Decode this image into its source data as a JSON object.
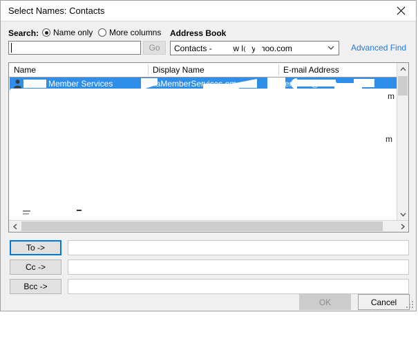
{
  "dialog": {
    "title": "Select Names: Contacts",
    "close_icon": "close-icon"
  },
  "search": {
    "label": "Search:",
    "input_value": "",
    "go_label": "Go",
    "go_enabled": false,
    "options": [
      {
        "label": "Name only",
        "selected": true
      },
      {
        "label": "More columns",
        "selected": false
      }
    ]
  },
  "address_book": {
    "label": "Address Book",
    "selected": "Contacts - hart_w l@yahoo.com",
    "dropdown_icon": "chevron-down-icon"
  },
  "advanced_find": {
    "label": "Advanced Find"
  },
  "list": {
    "columns": [
      "Name",
      "Display Name",
      "E-mail Address"
    ],
    "rows": [
      {
        "icon": "person-icon",
        "name": "Member Services",
        "display_name": "naMemberServices om",
        "email": "Services@ com",
        "selected": true
      }
    ],
    "stray_fragments": [
      "m",
      "m"
    ],
    "vertical_scrollbar": {
      "up_icon": "chevron-up-icon",
      "down_icon": "chevron-down-icon"
    },
    "horizontal_scrollbar": {
      "left_icon": "chevron-left-icon",
      "right_icon": "chevron-right-icon"
    }
  },
  "recipients": [
    {
      "button": "To ->",
      "value": "",
      "focused": true
    },
    {
      "button": "Cc ->",
      "value": "",
      "focused": false
    },
    {
      "button": "Bcc ->",
      "value": "",
      "focused": false
    }
  ],
  "footer": {
    "ok_label": "OK",
    "ok_enabled": false,
    "cancel_label": "Cancel"
  },
  "colors": {
    "selection_blue": "#2f8fe8",
    "link_blue": "#2577d4",
    "focus_blue": "#0078d7",
    "dialog_bg": "#f0f0f0"
  }
}
